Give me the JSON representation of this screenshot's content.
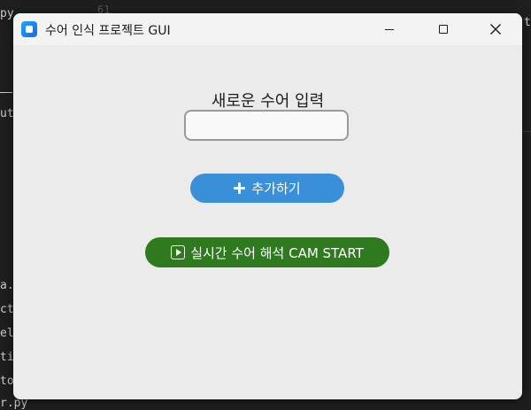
{
  "background": {
    "line_number": "61",
    "top_file": "py",
    "file_fragments": [
      "ut",
      "a.p",
      "cto",
      "el_",
      "tio",
      "tor",
      "r.py"
    ],
    "right_char": "t"
  },
  "window": {
    "title": "수어 인식 프로젝트 GUI",
    "controls": {
      "minimize_icon": "minimize-icon",
      "maximize_icon": "maximize-icon",
      "close_icon": "close-icon",
      "close_glyph": "✕"
    }
  },
  "form": {
    "heading": "새로운 수어 입력",
    "input_value": "",
    "input_placeholder": "",
    "add_button_label": "추가하기",
    "add_button_icon": "plus-icon"
  },
  "cam": {
    "button_label": "실시간 수어 해석 CAM START",
    "button_icon": "play-icon"
  },
  "colors": {
    "window_bg": "#ebebeb",
    "titlebar_bg": "#f3f3f3",
    "add_button": "#3a8fd9",
    "cam_button": "#2f7a1f",
    "app_icon": "#0b6fe0"
  }
}
